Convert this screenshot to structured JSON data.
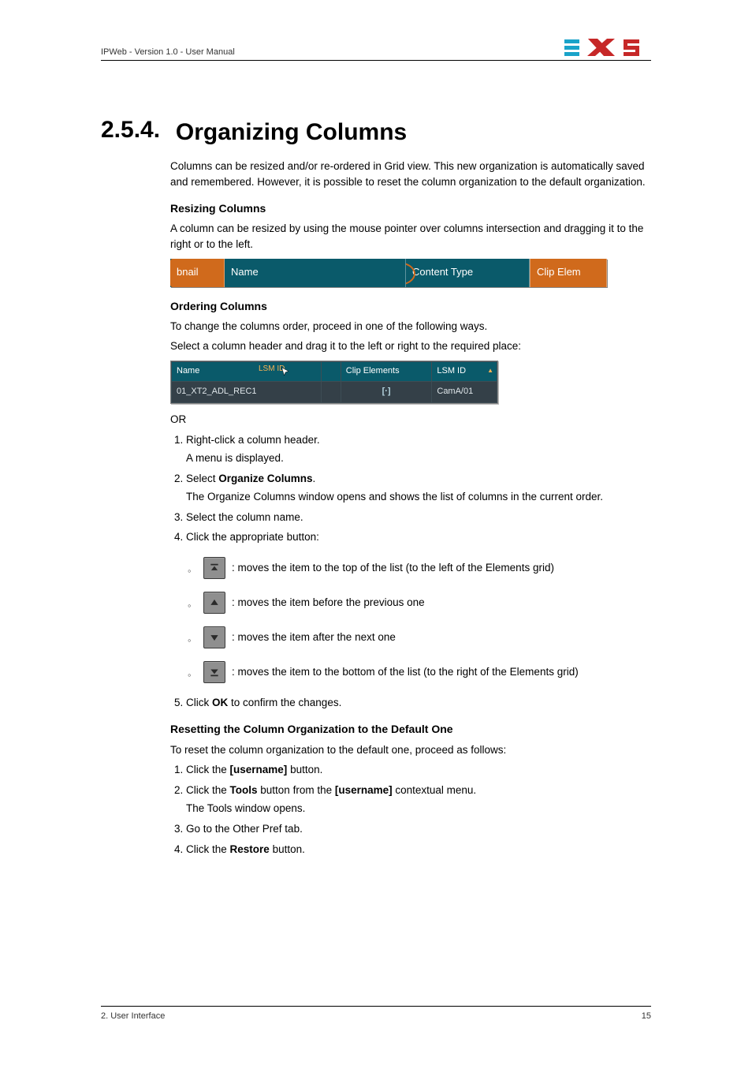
{
  "header": {
    "doc_title": "IPWeb - Version 1.0 - User Manual"
  },
  "section": {
    "number": "2.5.4.",
    "title": "Organizing Columns"
  },
  "intro": "Columns can be resized and/or re-ordered in Grid view. This new organization is automatically saved and remembered. However, it is possible to reset the column organization to the default organization.",
  "resize": {
    "heading": "Resizing Columns",
    "text": "A column can be resized by using the mouse pointer over columns intersection and dragging it to the right or to the left."
  },
  "illus1": {
    "col_bnail": "bnail",
    "col_name": "Name",
    "col_ctype": "Content Type",
    "col_clipelem": "Clip Elem",
    "resize_glyph": "⇔"
  },
  "order": {
    "heading": "Ordering Columns",
    "lead": "To change the columns order, proceed in one of the following ways.",
    "drag_instruction": "Select a column header and drag it to the left or right to the required place:"
  },
  "illus2": {
    "drag_hint": "LSM ID",
    "headers": {
      "name": "Name",
      "lsmid": "",
      "clip_elements": "Clip Elements",
      "lsm_id": "LSM ID"
    },
    "row": {
      "name": "01_XT2_ADL_REC1",
      "lsmid": "",
      "clip_elements": "[·]",
      "lsm_id": "CamA/01"
    }
  },
  "or_label": "OR",
  "ordered_steps": {
    "s1": "Right-click a column header.",
    "s1_sub": "A menu is displayed.",
    "s2_pre": "Select ",
    "s2_bold": "Organize Columns",
    "s2_post": ".",
    "s2_sub": "The Organize Columns window opens and shows the list of columns in the current order.",
    "s3": "Select the column name.",
    "s4": "Click the appropriate button:",
    "buttons": {
      "top": ": moves the item to the top of the list (to the left of the Elements grid)",
      "up": ": moves the item before the previous one",
      "down": ": moves the item after the next one",
      "bottom": ": moves the item to the bottom of the list (to the right of the Elements grid)"
    },
    "s5_pre": "Click ",
    "s5_bold": "OK",
    "s5_post": " to confirm the changes."
  },
  "reset": {
    "heading": "Resetting the Column Organization to the Default One",
    "lead": "To reset the column organization to the default one, proceed as follows:",
    "s1_pre": "Click the ",
    "s1_bold": "[username]",
    "s1_post": " button.",
    "s2_pre": "Click the ",
    "s2_bold1": "Tools",
    "s2_mid": " button from the ",
    "s2_bold2": "[username]",
    "s2_post": " contextual menu.",
    "s2_sub": "The Tools window opens.",
    "s3": "Go to the Other Pref tab.",
    "s4_pre": "Click the ",
    "s4_bold": "Restore",
    "s4_post": " button."
  },
  "footer": {
    "left": "2. User Interface",
    "right": "15"
  }
}
